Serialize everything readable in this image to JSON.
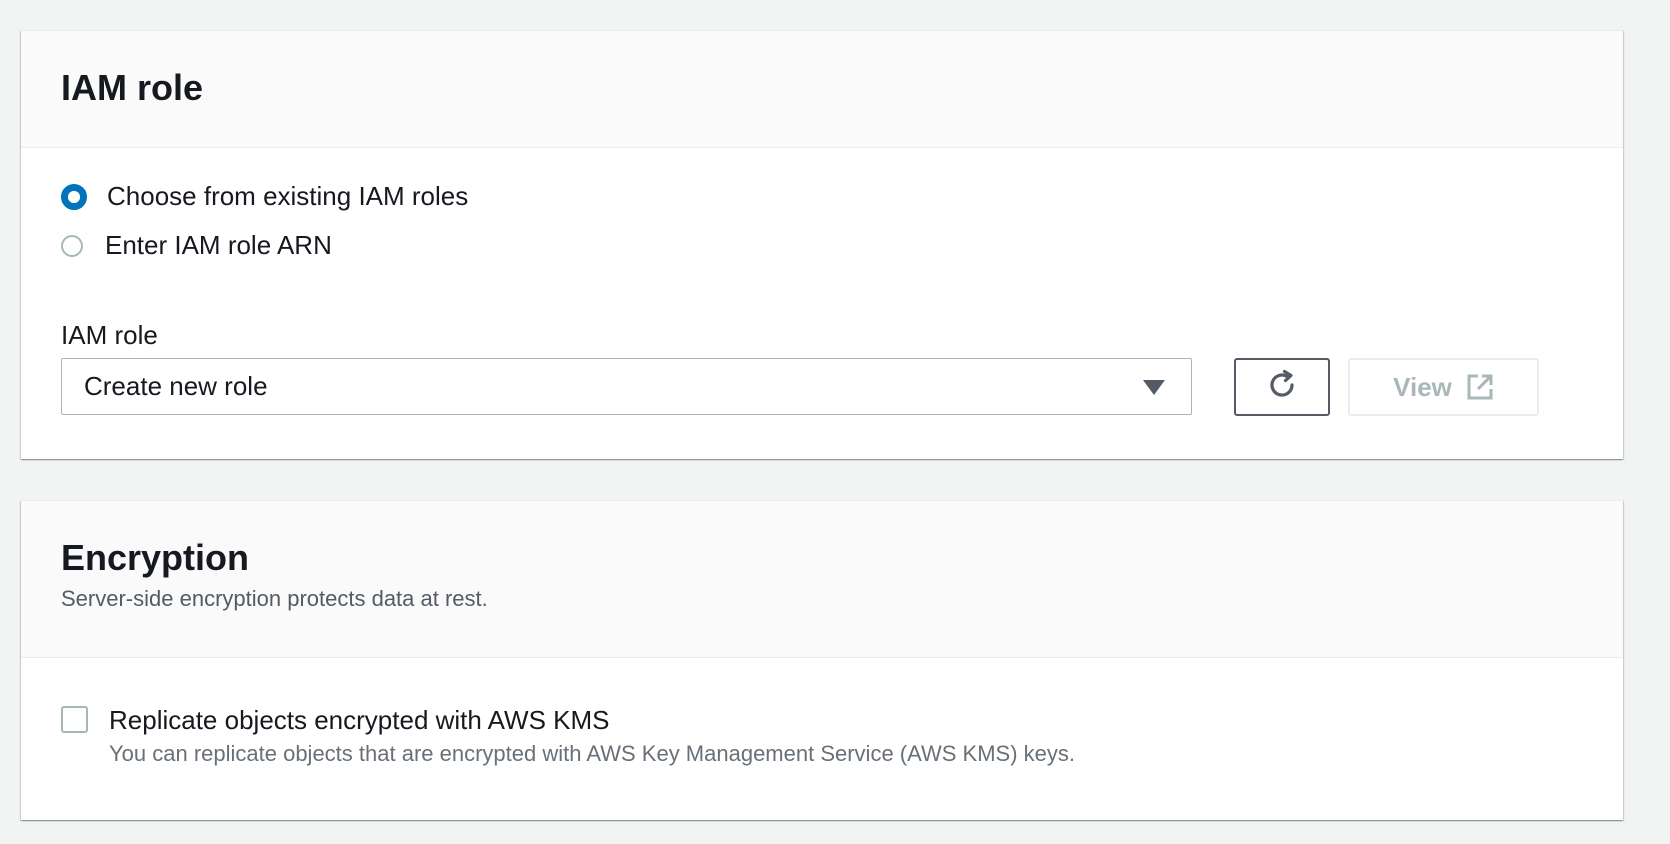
{
  "iam_section": {
    "title": "IAM role",
    "radio_options": [
      {
        "label": "Choose from existing IAM roles",
        "checked": true
      },
      {
        "label": "Enter IAM role ARN",
        "checked": false
      }
    ],
    "field_label": "IAM role",
    "select_value": "Create new role",
    "refresh_icon": "refresh-icon",
    "view_button_label": "View",
    "view_button_icon": "external-link-icon"
  },
  "encryption_section": {
    "title": "Encryption",
    "description": "Server-side encryption protects data at rest.",
    "checkbox_label": "Replicate objects encrypted with AWS KMS",
    "checkbox_description": "You can replicate objects that are encrypted with AWS Key Management Service (AWS KMS) keys.",
    "checkbox_checked": false
  },
  "colors": {
    "page_background": "#f2f3f3",
    "accent": "#0073bb",
    "disabled_text": "#aab7b8"
  }
}
